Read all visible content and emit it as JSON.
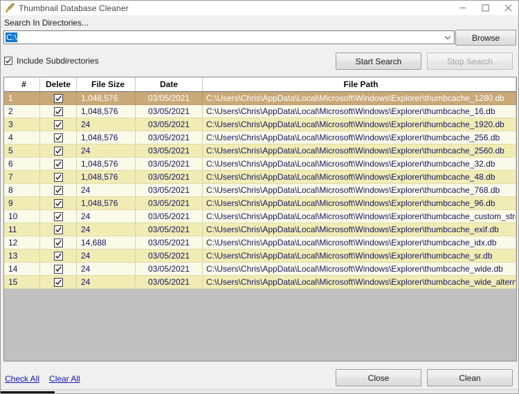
{
  "window": {
    "title": "Thumbnail Database Cleaner",
    "icon": "broom-icon",
    "controls": {
      "minimize": "minimize-icon",
      "maximize": "maximize-icon",
      "close": "close-icon"
    }
  },
  "search": {
    "label": "Search In Directories...",
    "directory_value": "C:\\",
    "dropdown_icon": "chevron-down-icon",
    "browse_label": "Browse",
    "include_subdirectories_label": "Include Subdirectories",
    "include_subdirectories_checked": true,
    "start_label": "Start Search",
    "stop_label": "Stop Search",
    "stop_disabled": true
  },
  "grid": {
    "columns": [
      "#",
      "Delete",
      "File Size",
      "Date",
      "File Path"
    ],
    "rows": [
      {
        "num": "1",
        "size": "1,048,576",
        "date": "03/05/2021",
        "path": "C:\\Users\\Chris\\AppData\\Local\\Microsoft\\Windows\\Explorer\\thumbcache_1280.db",
        "checked": true,
        "selected": true
      },
      {
        "num": "2",
        "size": "1,048,576",
        "date": "03/05/2021",
        "path": "C:\\Users\\Chris\\AppData\\Local\\Microsoft\\Windows\\Explorer\\thumbcache_16.db",
        "checked": true,
        "selected": false
      },
      {
        "num": "3",
        "size": "24",
        "date": "03/05/2021",
        "path": "C:\\Users\\Chris\\AppData\\Local\\Microsoft\\Windows\\Explorer\\thumbcache_1920.db",
        "checked": true,
        "selected": false
      },
      {
        "num": "4",
        "size": "1,048,576",
        "date": "03/05/2021",
        "path": "C:\\Users\\Chris\\AppData\\Local\\Microsoft\\Windows\\Explorer\\thumbcache_256.db",
        "checked": true,
        "selected": false
      },
      {
        "num": "5",
        "size": "24",
        "date": "03/05/2021",
        "path": "C:\\Users\\Chris\\AppData\\Local\\Microsoft\\Windows\\Explorer\\thumbcache_2560.db",
        "checked": true,
        "selected": false
      },
      {
        "num": "6",
        "size": "1,048,576",
        "date": "03/05/2021",
        "path": "C:\\Users\\Chris\\AppData\\Local\\Microsoft\\Windows\\Explorer\\thumbcache_32.db",
        "checked": true,
        "selected": false
      },
      {
        "num": "7",
        "size": "1,048,576",
        "date": "03/05/2021",
        "path": "C:\\Users\\Chris\\AppData\\Local\\Microsoft\\Windows\\Explorer\\thumbcache_48.db",
        "checked": true,
        "selected": false
      },
      {
        "num": "8",
        "size": "24",
        "date": "03/05/2021",
        "path": "C:\\Users\\Chris\\AppData\\Local\\Microsoft\\Windows\\Explorer\\thumbcache_768.db",
        "checked": true,
        "selected": false
      },
      {
        "num": "9",
        "size": "1,048,576",
        "date": "03/05/2021",
        "path": "C:\\Users\\Chris\\AppData\\Local\\Microsoft\\Windows\\Explorer\\thumbcache_96.db",
        "checked": true,
        "selected": false
      },
      {
        "num": "10",
        "size": "24",
        "date": "03/05/2021",
        "path": "C:\\Users\\Chris\\AppData\\Local\\Microsoft\\Windows\\Explorer\\thumbcache_custom_stream.db",
        "checked": true,
        "selected": false
      },
      {
        "num": "11",
        "size": "24",
        "date": "03/05/2021",
        "path": "C:\\Users\\Chris\\AppData\\Local\\Microsoft\\Windows\\Explorer\\thumbcache_exif.db",
        "checked": true,
        "selected": false
      },
      {
        "num": "12",
        "size": "14,688",
        "date": "03/05/2021",
        "path": "C:\\Users\\Chris\\AppData\\Local\\Microsoft\\Windows\\Explorer\\thumbcache_idx.db",
        "checked": true,
        "selected": false
      },
      {
        "num": "13",
        "size": "24",
        "date": "03/05/2021",
        "path": "C:\\Users\\Chris\\AppData\\Local\\Microsoft\\Windows\\Explorer\\thumbcache_sr.db",
        "checked": true,
        "selected": false
      },
      {
        "num": "14",
        "size": "24",
        "date": "03/05/2021",
        "path": "C:\\Users\\Chris\\AppData\\Local\\Microsoft\\Windows\\Explorer\\thumbcache_wide.db",
        "checked": true,
        "selected": false
      },
      {
        "num": "15",
        "size": "24",
        "date": "03/05/2021",
        "path": "C:\\Users\\Chris\\AppData\\Local\\Microsoft\\Windows\\Explorer\\thumbcache_wide_alternate.db",
        "checked": true,
        "selected": false
      }
    ]
  },
  "footer": {
    "check_all_label": "Check All",
    "clear_all_label": "Clear All",
    "close_label": "Close",
    "clean_label": "Clean"
  },
  "colors": {
    "selection_row": "#c9a978",
    "row_even": "#f0ecb4",
    "row_odd": "#fbfae8",
    "path_text": "#151560",
    "link": "#1414c8",
    "combo_selection": "#0a72d1",
    "grid_background": "#c0c0c0"
  }
}
